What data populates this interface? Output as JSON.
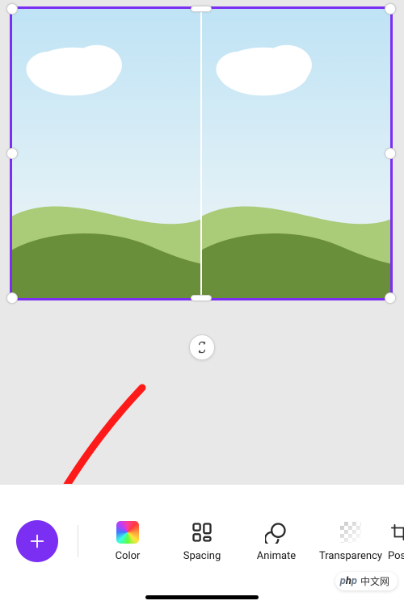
{
  "canvas": {
    "grid": {
      "columns": 2,
      "rows": 1
    },
    "selected": true
  },
  "swap_button": {
    "name": "swap-images"
  },
  "toolbar": {
    "add_label": "+",
    "tools": [
      {
        "key": "color",
        "label": "Color"
      },
      {
        "key": "spacing",
        "label": "Spacing"
      },
      {
        "key": "animate",
        "label": "Animate"
      },
      {
        "key": "transparency",
        "label": "Transparency"
      },
      {
        "key": "position",
        "label": "Posi"
      }
    ]
  },
  "watermark": {
    "prefix": "php",
    "text": "中文网"
  },
  "annotation": {
    "arrow_target": "add-button"
  },
  "colors": {
    "accent": "#7a2ff2",
    "arrow": "#ff1a1a"
  }
}
